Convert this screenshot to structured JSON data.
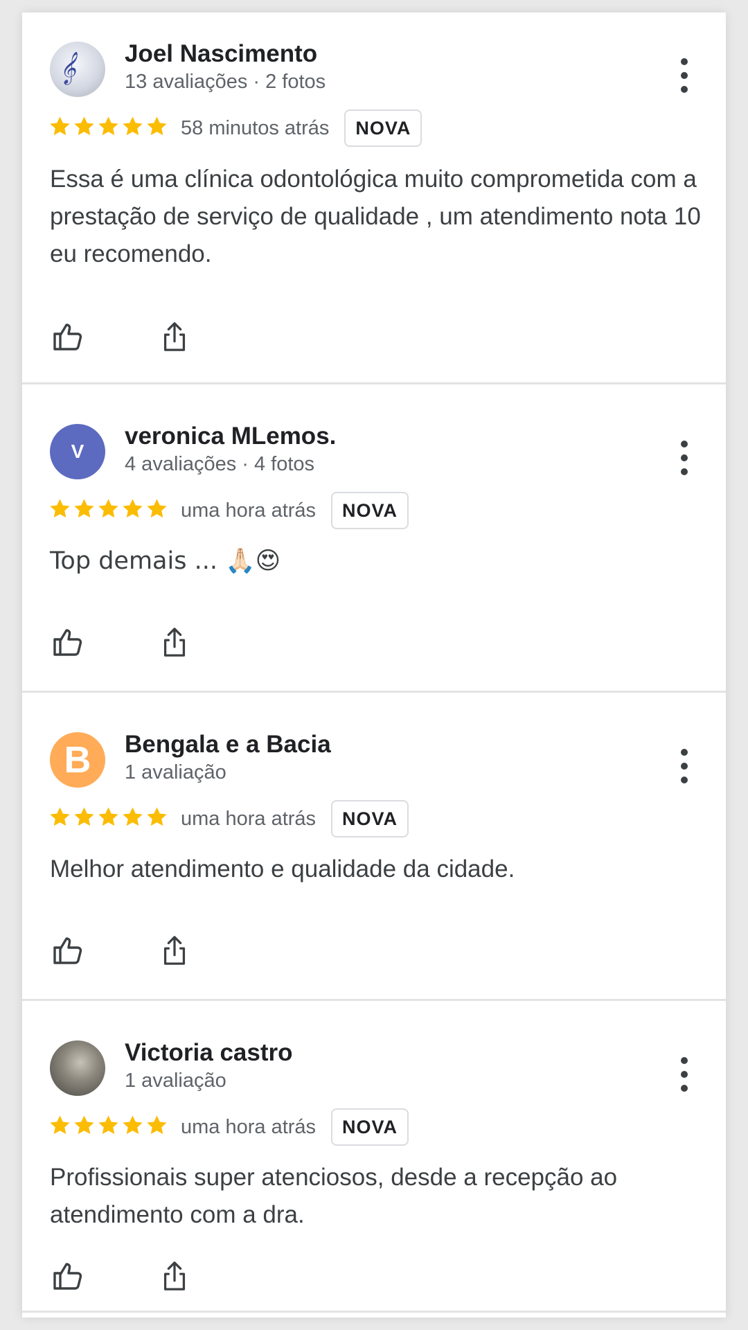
{
  "reviews": [
    {
      "name": "Joel Nascimento",
      "meta": "13 avaliações · 2 fotos",
      "avatar": {
        "type": "photo",
        "initial": ""
      },
      "rating": 5,
      "time": "58 minutos atrás",
      "badge": "NOVA",
      "text": "Essa é uma clínica odontológica muito comprometida com a prestação de serviço de qualidade , um atendimento nota 10 eu recomendo."
    },
    {
      "name": "veronica MLemos.",
      "meta": "4 avaliações · 4 fotos",
      "avatar": {
        "type": "letter",
        "initial": "V",
        "color": "#5c6bc0"
      },
      "rating": 5,
      "time": "uma hora atrás",
      "badge": "NOVA",
      "text": "Top demais ... 🙏🏻😍"
    },
    {
      "name": "Bengala e a Bacia",
      "meta": "1 avaliação",
      "avatar": {
        "type": "letter",
        "initial": "B",
        "color": "#ffab57"
      },
      "rating": 5,
      "time": "uma hora atrás",
      "badge": "NOVA",
      "text": "Melhor atendimento e qualidade da cidade."
    },
    {
      "name": "Victoria castro",
      "meta": "1 avaliação",
      "avatar": {
        "type": "photo",
        "initial": ""
      },
      "rating": 5,
      "time": "uma hora atrás",
      "badge": "NOVA",
      "text": "Profissionais super atenciosos, desde a recepção ao atendimento com a dra."
    }
  ],
  "icons": {
    "star": "star-icon",
    "like": "thumbs-up-icon",
    "share": "share-icon",
    "more": "more-vert-icon"
  },
  "colors": {
    "star": "#fbbc04",
    "name": "#202124",
    "secondary": "#5f6368",
    "body": "#3c4043"
  }
}
